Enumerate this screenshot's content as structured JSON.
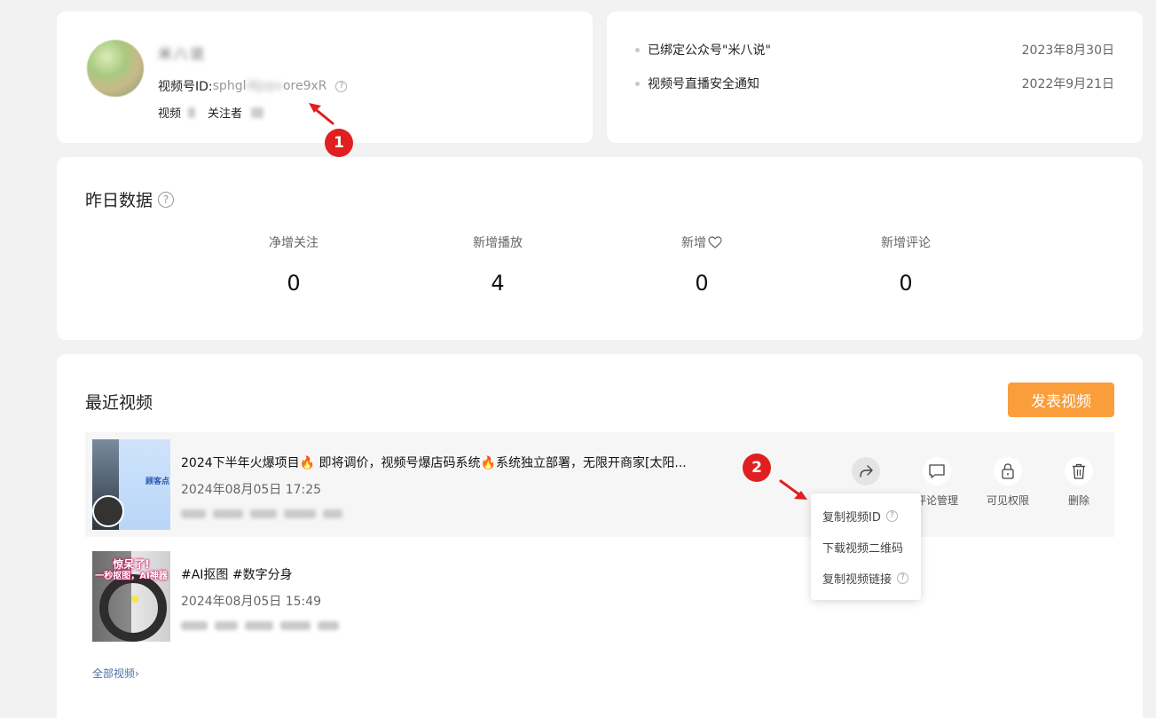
{
  "profile": {
    "nickname": "米八说",
    "id_label": "视频号ID:",
    "id_visible_start": "sphgl",
    "id_blurred_mid": "i8Jzpv",
    "id_visible_end": "ore9xR",
    "videos_label": "视频",
    "followers_label": "关注者"
  },
  "markers": {
    "one": "1",
    "two": "2"
  },
  "notices": [
    {
      "text": "已绑定公众号\"米八说\"",
      "date": "2023年8月30日"
    },
    {
      "text": "视频号直播安全通知",
      "date": "2022年9月21日"
    }
  ],
  "yesterday": {
    "title": "昨日数据",
    "metrics": [
      {
        "label": "净增关注",
        "value": "0"
      },
      {
        "label": "新增播放",
        "value": "4"
      },
      {
        "label": "新增",
        "value": "0",
        "icon": "heart-icon"
      },
      {
        "label": "新增评论",
        "value": "0"
      }
    ]
  },
  "recent": {
    "title": "最近视频",
    "publish_label": "发表视频",
    "all_videos_label": "全部视频",
    "videos": [
      {
        "title": "2024下半年火爆项目🔥 即将调价，视频号爆店码系统🔥系统独立部署，无限开商家[太阳...",
        "time": "2024年08月05日 17:25",
        "thumb_text": "顾客点"
      },
      {
        "title": "#AI抠图 #数字分身",
        "time": "2024年08月05日 15:49",
        "thumb_caption_1": "惊呆了!",
        "thumb_caption_2": "一秒抠图，AI神器"
      }
    ],
    "actions": [
      {
        "label": "分享",
        "icon": "share-icon"
      },
      {
        "label": "评论管理",
        "icon": "comment-icon"
      },
      {
        "label": "可见权限",
        "icon": "lock-icon"
      },
      {
        "label": "删除",
        "icon": "trash-icon"
      }
    ],
    "share_menu": [
      {
        "label": "复制视频ID",
        "help": true
      },
      {
        "label": "下载视频二维码",
        "help": false
      },
      {
        "label": "复制视频链接",
        "help": true
      }
    ]
  },
  "colors": {
    "page_bg": "#f2f2f2",
    "accent_orange": "#fa9d3b",
    "marker_red": "#e02020",
    "link_blue": "#4a6fa5"
  }
}
